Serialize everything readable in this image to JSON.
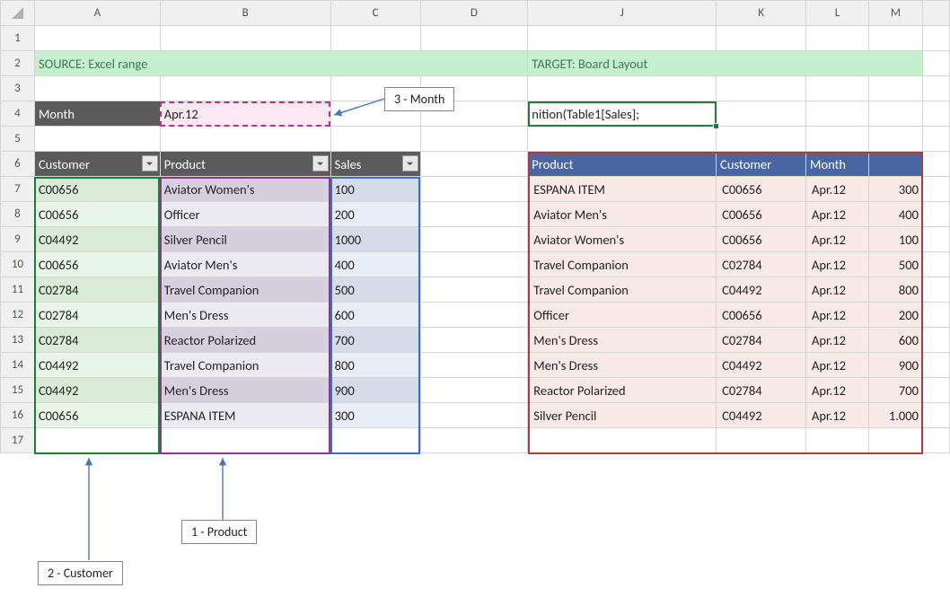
{
  "columns": [
    "A",
    "B",
    "C",
    "D",
    "J",
    "K",
    "L",
    "M"
  ],
  "rows": [
    "1",
    "2",
    "3",
    "4",
    "5",
    "6",
    "7",
    "8",
    "9",
    "10",
    "11",
    "12",
    "13",
    "14",
    "15",
    "16",
    "17"
  ],
  "titles": {
    "source": "SOURCE: Excel range",
    "target": "TARGET: Board Layout"
  },
  "month": {
    "label": "Month",
    "value": "Apr.12"
  },
  "formula": "nition(Table1[Sales];",
  "left_table": {
    "headers": [
      "Customer",
      "Product",
      "Sales"
    ],
    "rows": [
      {
        "customer": "C00656",
        "product": "Aviator Women's",
        "sales": "100"
      },
      {
        "customer": "C00656",
        "product": "Officer",
        "sales": "200"
      },
      {
        "customer": "C04492",
        "product": "Silver Pencil",
        "sales": "1000"
      },
      {
        "customer": "C00656",
        "product": "Aviator Men's",
        "sales": "400"
      },
      {
        "customer": "C02784",
        "product": "Travel Companion",
        "sales": "500"
      },
      {
        "customer": "C02784",
        "product": "Men's Dress",
        "sales": "600"
      },
      {
        "customer": "C02784",
        "product": "Reactor Polarized",
        "sales": "700"
      },
      {
        "customer": "C04492",
        "product": "Travel Companion",
        "sales": "800"
      },
      {
        "customer": "C04492",
        "product": "Men's Dress",
        "sales": "900"
      },
      {
        "customer": "C00656",
        "product": "ESPANA ITEM",
        "sales": "300"
      }
    ]
  },
  "right_table": {
    "headers": [
      "Product",
      "Customer",
      "Month",
      ""
    ],
    "rows": [
      {
        "product": "ESPANA ITEM",
        "customer": "C00656",
        "month": "Apr.12",
        "value": "300"
      },
      {
        "product": "Aviator Men's",
        "customer": "C00656",
        "month": "Apr.12",
        "value": "400"
      },
      {
        "product": "Aviator Women's",
        "customer": "C00656",
        "month": "Apr.12",
        "value": "100"
      },
      {
        "product": "Travel Companion",
        "customer": "C02784",
        "month": "Apr.12",
        "value": "500"
      },
      {
        "product": "Travel Companion",
        "customer": "C04492",
        "month": "Apr.12",
        "value": "800"
      },
      {
        "product": "Officer",
        "customer": "C00656",
        "month": "Apr.12",
        "value": "200"
      },
      {
        "product": "Men's Dress",
        "customer": "C02784",
        "month": "Apr.12",
        "value": "600"
      },
      {
        "product": "Men's Dress",
        "customer": "C04492",
        "month": "Apr.12",
        "value": "900"
      },
      {
        "product": "Reactor Polarized",
        "customer": "C02784",
        "month": "Apr.12",
        "value": "700"
      },
      {
        "product": "Silver Pencil",
        "customer": "C04492",
        "month": "Apr.12",
        "value": "1.000"
      }
    ]
  },
  "callouts": {
    "month": "3 - Month",
    "product": "1 - Product",
    "customer": "2 - Customer"
  },
  "colors": {
    "green": "#1e7e34",
    "purple": "#8b3a8b",
    "magenta": "#b63291",
    "blue": "#3b6fc4",
    "red": "#a93d3d",
    "arrow": "#4a74b8"
  }
}
